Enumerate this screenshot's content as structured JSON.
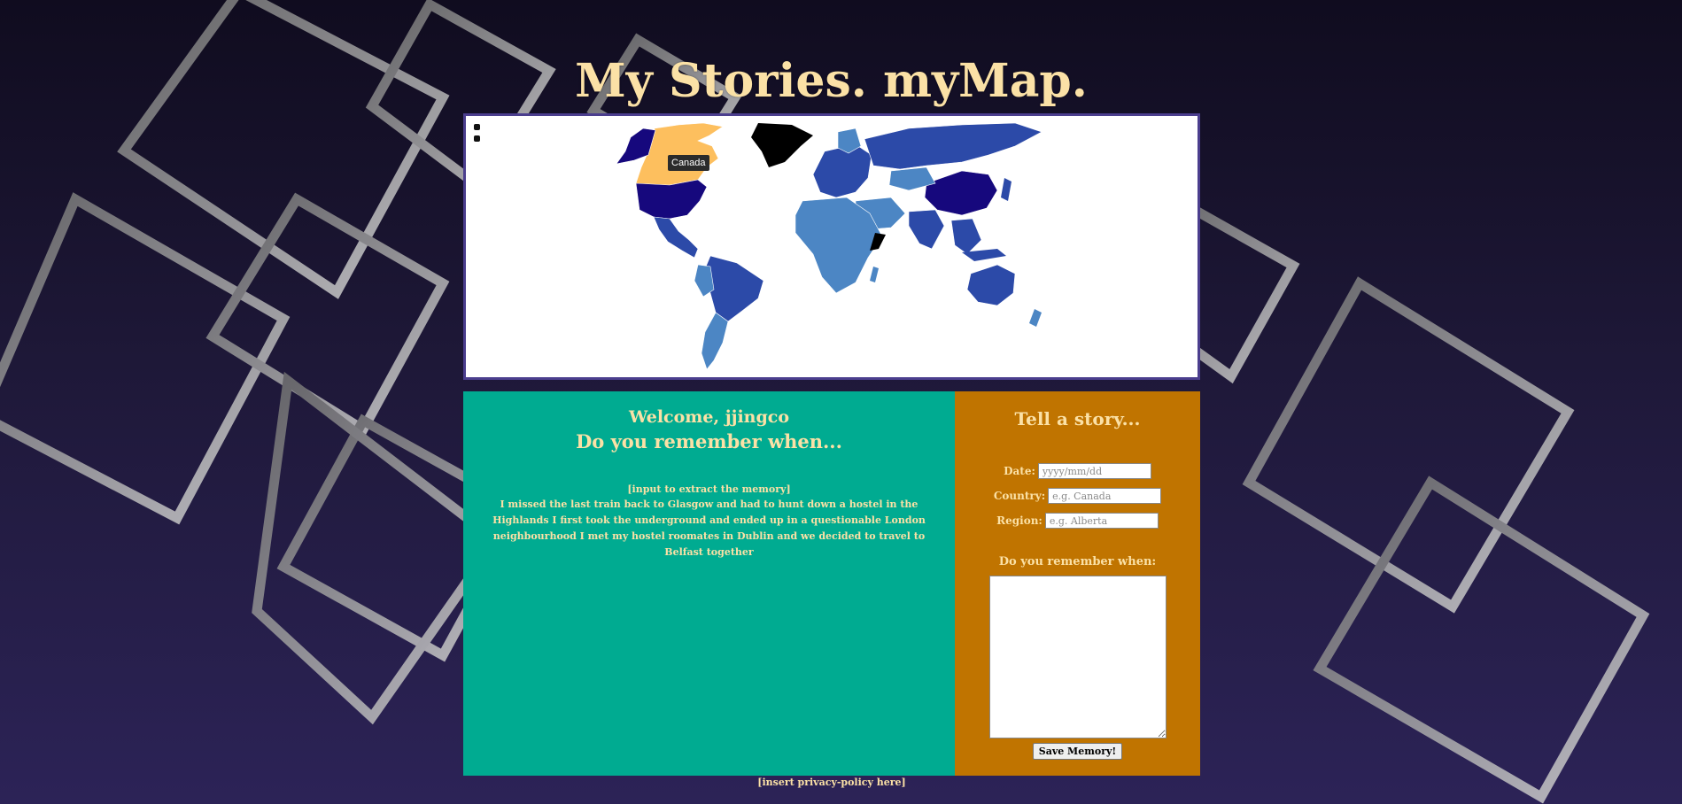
{
  "header": {
    "title": "My Stories. myMap."
  },
  "map": {
    "tooltip": "Canada",
    "colors": {
      "highlight": "#fdbf5e",
      "dark": "#16087d",
      "medium": "#2c4aa8",
      "light": "#4c86c4",
      "black": "#000000"
    }
  },
  "welcome": {
    "greeting": "Welcome, jjingco",
    "question": "Do you remember when...",
    "extract_note": "[input to extract the memory]",
    "memory": "I missed the last train back to Glasgow and had to hunt down a hostel in the Highlands I first took the underground and ended up in a questionable London neighbourhood I met my hostel roomates in Dublin and we decided to travel to Belfast together"
  },
  "story_form": {
    "title": "Tell a story...",
    "date_label": "Date:",
    "date_placeholder": "yyyy/mm/dd",
    "country_label": "Country:",
    "country_placeholder": "e.g. Canada",
    "region_label": "Region:",
    "region_placeholder": "e.g. Alberta",
    "remember_label": "Do you remember when:",
    "save_label": "Save Memory!"
  },
  "footer": {
    "privacy_link": "[insert privacy-policy here]"
  },
  "theme": {
    "title_color": "#fbe1a6",
    "left_panel_color": "#00ab91",
    "right_panel_color": "#c07400",
    "map_border_color": "#4b3e8e"
  }
}
